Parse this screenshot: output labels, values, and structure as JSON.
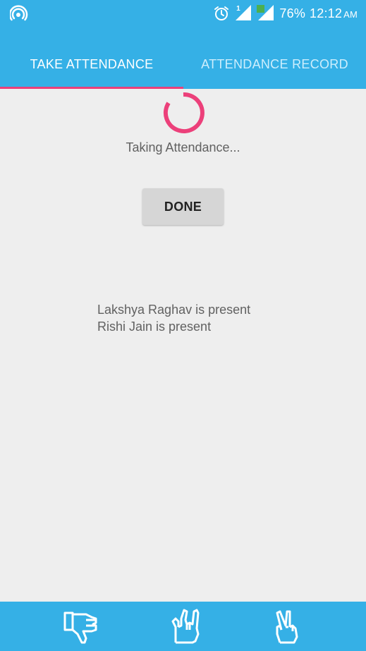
{
  "status_bar": {
    "battery": "76%",
    "time": "12:12",
    "ampm": "AM",
    "sim_badge": "1",
    "icons": [
      "hotspot-icon",
      "alarm-icon",
      "signal-icon",
      "signal-icon",
      "battery-level"
    ]
  },
  "tabs": [
    {
      "label": "TAKE ATTENDANCE",
      "selected": true
    },
    {
      "label": "ATTENDANCE RECORD",
      "selected": false
    }
  ],
  "main": {
    "progress_text": "Taking Attendance...",
    "done_button": "DONE",
    "records": [
      "Lakshya Raghav is present",
      "Rishi Jain is present"
    ]
  },
  "bottom_bar": {
    "icons": [
      "thumbs-down-icon",
      "rock-hand-icon",
      "peace-hand-icon"
    ]
  },
  "colors": {
    "primary": "#35b0e6",
    "accent": "#ec407a",
    "background": "#eeeeee",
    "button": "#d6d6d6"
  }
}
